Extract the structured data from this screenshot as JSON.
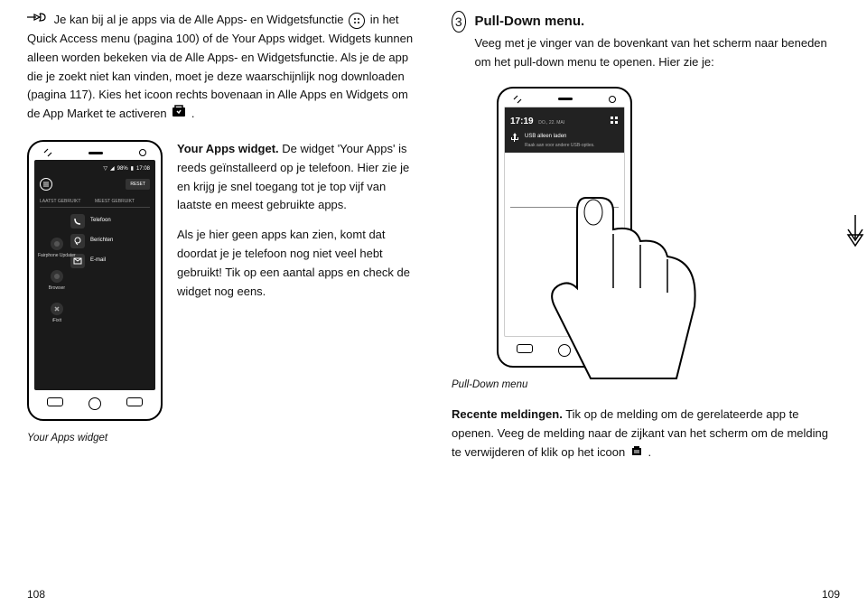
{
  "left": {
    "para1_start": "Je kan bij al je apps via de Alle Apps- en Widgetsfunctie ",
    "para1_mid": " in het Quick Access menu (pagina 100) of de Your Apps widget. Widgets kunnen alleen worden bekeken via de Alle Apps- en Widgetsfunctie. Als je de app die je zoekt niet kan vinden, moet je deze waarschijnlijk nog downloaden (pagina 117). Kies het icoon rechts bovenaan in Alle Apps en Widgets om de App Market te activeren ",
    "para1_end": ".",
    "block2_title": "Your Apps widget.",
    "block2_rest": " De widget 'Your Apps' is reeds geïnstalleerd op je telefoon. Hier zie je en krijg je snel toegang tot je top vijf van laatste en meest gebruikte apps.",
    "block3": "Als je hier geen apps kan zien, komt dat doordat je je telefoon nog niet veel hebt gebruikt! Tik op een aantal apps en check de widget nog eens.",
    "phone1": {
      "status_time": "17:08",
      "status_batt": "98%",
      "reset": "RESET",
      "tab1": "LAATST GEBRUIKT",
      "tab2": "MEEST GEBRUIKT",
      "apps": [
        "Telefoon",
        "Berichten",
        "E-mail"
      ],
      "side": [
        "Fairphone Updater",
        "Browser",
        "iFixit"
      ]
    },
    "caption1": "Your Apps widget"
  },
  "right": {
    "step": "3",
    "title": "Pull-Down menu.",
    "intro": "Veeg met je vinger van de bovenkant van het scherm naar beneden om het pull-down menu te openen. Hier zie je:",
    "phone2": {
      "time": "17:19",
      "date": "DO., 22. MAI",
      "usb_title": "USB alleen laden",
      "usb_sub": "Raak aan voor andere USB-opties."
    },
    "caption2": "Pull-Down menu",
    "recent_title": "Recente meldingen.",
    "recent_rest_a": " Tik op de melding om de gerelateerde app te openen. Veeg de melding naar de zijkant van het scherm om de melding te verwijderen of klik op het icoon ",
    "recent_rest_b": "."
  },
  "page_left": "108",
  "page_right": "109"
}
